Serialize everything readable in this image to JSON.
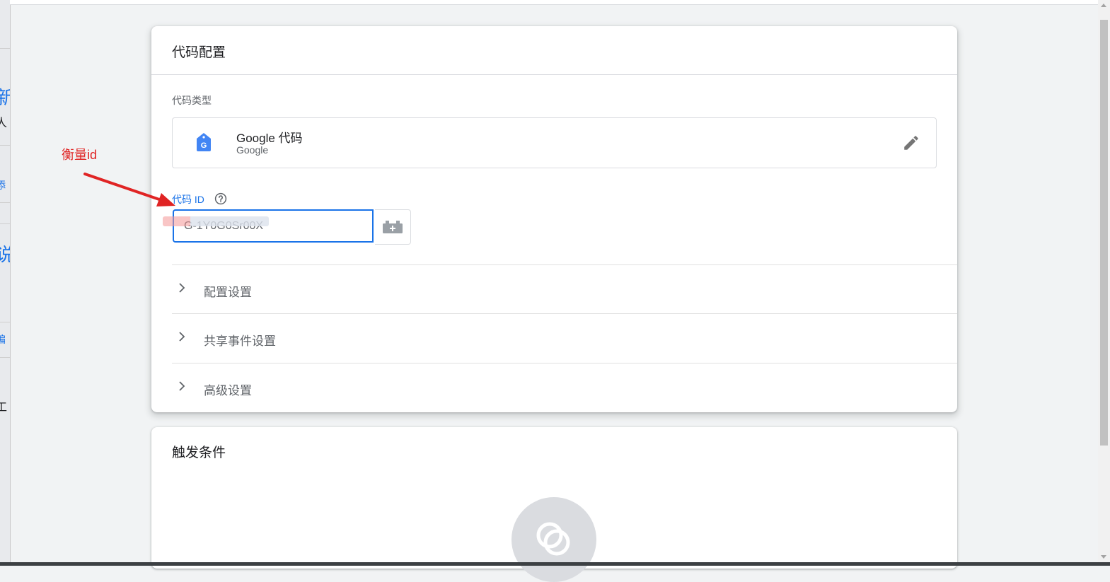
{
  "backdrop": {
    "fragments": [
      "新",
      "人",
      "添",
      "说",
      "编",
      "工"
    ]
  },
  "code_config": {
    "title": "代码配置",
    "tag_type_label": "代码类型",
    "tag_type": {
      "name": "Google 代码",
      "vendor": "Google",
      "icon": "google-tag-icon"
    },
    "tag_id_label": "代码 ID",
    "tag_id_value": "G-1Y0G0Sr00X",
    "sections": [
      {
        "label": "配置设置"
      },
      {
        "label": "共享事件设置"
      },
      {
        "label": "高级设置"
      }
    ]
  },
  "triggering": {
    "title": "触发条件"
  },
  "annotation": {
    "text": "衡量id",
    "color": "#e02424"
  },
  "colors": {
    "accent": "#1a73e8",
    "tag_blue": "#4285f4"
  }
}
